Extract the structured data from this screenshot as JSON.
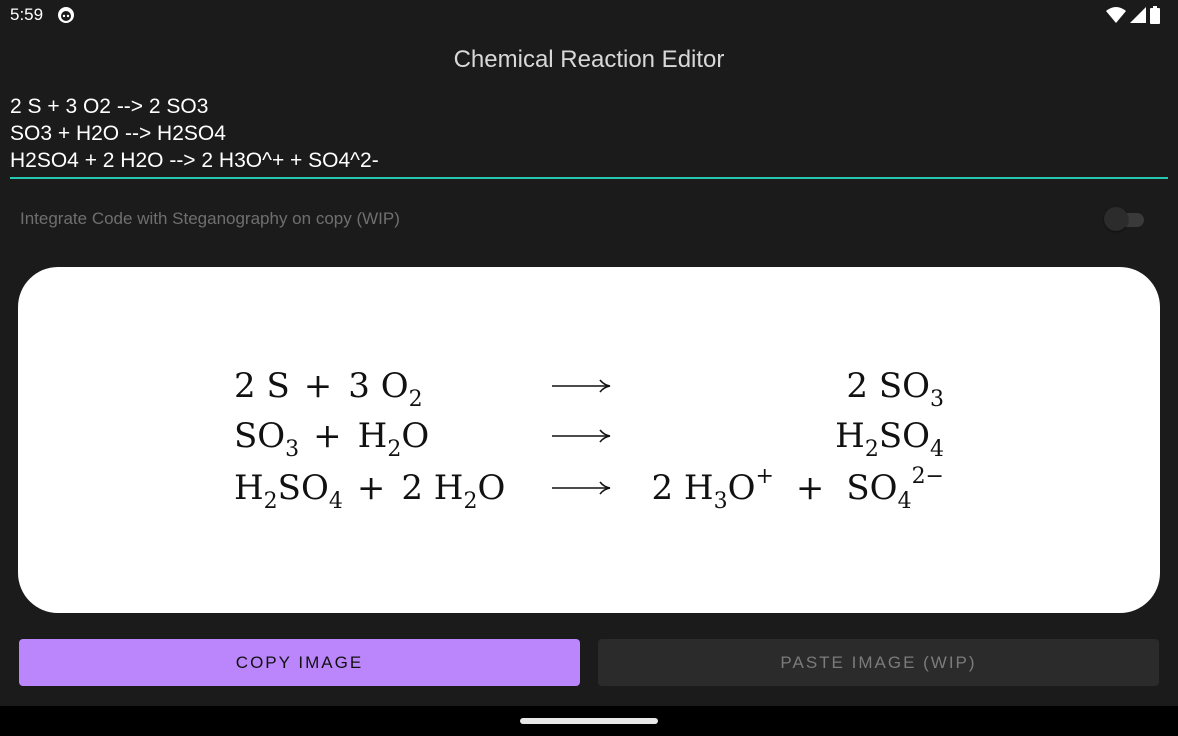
{
  "status_bar": {
    "time": "5:59",
    "icons": [
      "app-notification-icon",
      "wifi-icon",
      "signal-icon",
      "battery-icon"
    ]
  },
  "app": {
    "title": "Chemical Reaction Editor"
  },
  "editor": {
    "lines": [
      "2 S + 3 O2 --> 2 SO3",
      "SO3 + H2O --> H2SO4",
      "H2SO4 + 2 H2O --> 2 H3O^+ + SO4^2-"
    ]
  },
  "steganography_toggle": {
    "label": "Integrate Code with Steganography on copy (WIP)",
    "enabled": false
  },
  "preview": {
    "reactions": [
      {
        "lhs": [
          {
            "coef": "2",
            "base": "S"
          },
          {
            "coef": "3",
            "base": "O",
            "sub": "2"
          }
        ],
        "rhs": [
          {
            "coef": "2",
            "base": "SO",
            "sub": "3"
          }
        ]
      },
      {
        "lhs": [
          {
            "coef": "",
            "base": "SO",
            "sub": "3"
          },
          {
            "coef": "",
            "base": "H",
            "sub": "2",
            "tail": "O"
          }
        ],
        "rhs": [
          {
            "coef": "",
            "base": "H",
            "sub": "2",
            "tail": "SO",
            "sub2": "4"
          }
        ]
      },
      {
        "lhs": [
          {
            "coef": "",
            "base": "H",
            "sub": "2",
            "tail": "SO",
            "sub2": "4"
          },
          {
            "coef": "2",
            "base": "H",
            "sub": "2",
            "tail": "O"
          }
        ],
        "rhs": [
          {
            "coef": "2",
            "base": "H",
            "sub": "3",
            "tail": "O",
            "sup": "+"
          },
          {
            "coef": "",
            "base": "SO",
            "sub": "4",
            "sup": "2−"
          }
        ]
      }
    ]
  },
  "buttons": {
    "copy": "COPY IMAGE",
    "paste": "PASTE IMAGE (WIP)"
  },
  "colors": {
    "accent": "#26c6b0",
    "primary": "#bb86fc",
    "background": "#1b1b1b"
  }
}
